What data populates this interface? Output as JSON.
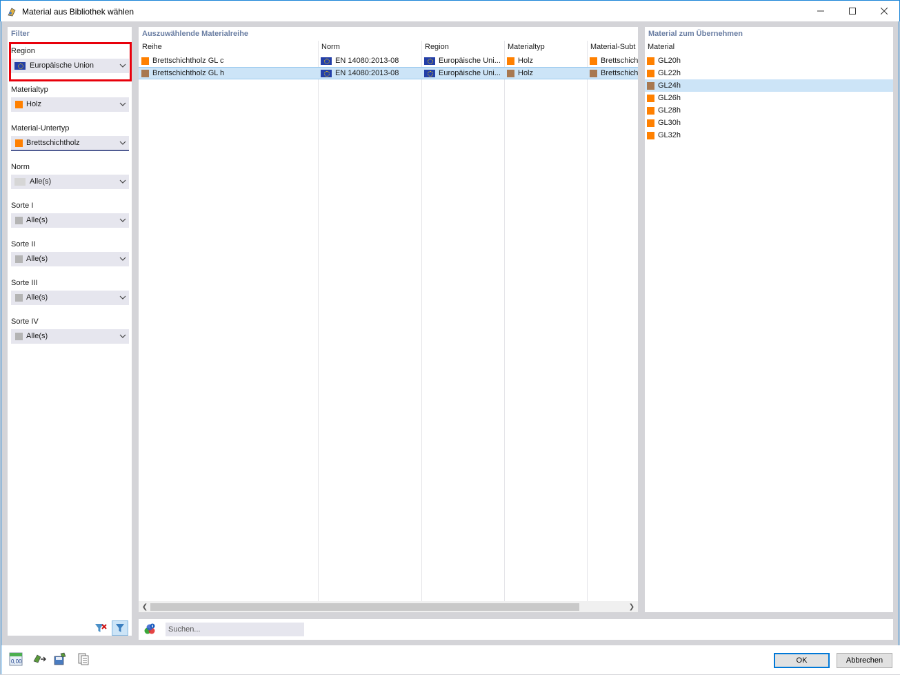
{
  "window": {
    "title": "Material aus Bibliothek wählen"
  },
  "colors": {
    "orange": "#ff8000",
    "brown": "#a87850",
    "gray": "#b4b4b4",
    "selection": "#cce4f7",
    "accent": "#0078d7",
    "highlight": "#e8000b"
  },
  "filter": {
    "title": "Filter",
    "fields": [
      {
        "label": "Region",
        "value": "Europäische Union",
        "icon": "eu-flag-icon"
      },
      {
        "label": "Materialtyp",
        "value": "Holz",
        "icon": "orange-swatch"
      },
      {
        "label": "Material-Untertyp",
        "value": "Brettschichtholz",
        "icon": "orange-swatch"
      },
      {
        "label": "Norm",
        "value": "Alle(s)",
        "icon": "gray-swatch"
      },
      {
        "label": "Sorte I",
        "value": "Alle(s)",
        "icon": "gray-swatch"
      },
      {
        "label": "Sorte II",
        "value": "Alle(s)",
        "icon": "gray-swatch"
      },
      {
        "label": "Sorte III",
        "value": "Alle(s)",
        "icon": "gray-swatch"
      },
      {
        "label": "Sorte IV",
        "value": "Alle(s)",
        "icon": "gray-swatch"
      }
    ]
  },
  "series": {
    "title": "Auszuwählende Materialreihe",
    "columns": [
      "Reihe",
      "Norm",
      "Region",
      "Materialtyp",
      "Material-Subt"
    ],
    "rows": [
      {
        "reihe": "Brettschichtholz GL c",
        "norm": "EN 14080:2013-08",
        "region": "Europäische Uni...",
        "typ": "Holz",
        "subtyp": "Brettschich",
        "selected": false
      },
      {
        "reihe": "Brettschichtholz GL h",
        "norm": "EN 14080:2013-08",
        "region": "Europäische Uni...",
        "typ": "Holz",
        "subtyp": "Brettschich",
        "selected": true
      }
    ]
  },
  "materials": {
    "title": "Material zum Übernehmen",
    "column": "Material",
    "items": [
      {
        "name": "GL20h",
        "selected": false
      },
      {
        "name": "GL22h",
        "selected": false
      },
      {
        "name": "GL24h",
        "selected": true
      },
      {
        "name": "GL26h",
        "selected": false
      },
      {
        "name": "GL28h",
        "selected": false
      },
      {
        "name": "GL30h",
        "selected": false
      },
      {
        "name": "GL32h",
        "selected": false
      }
    ]
  },
  "search": {
    "placeholder": "Suchen..."
  },
  "bottom": {
    "units_label": "0,00",
    "ok": "OK",
    "cancel": "Abbrechen"
  }
}
